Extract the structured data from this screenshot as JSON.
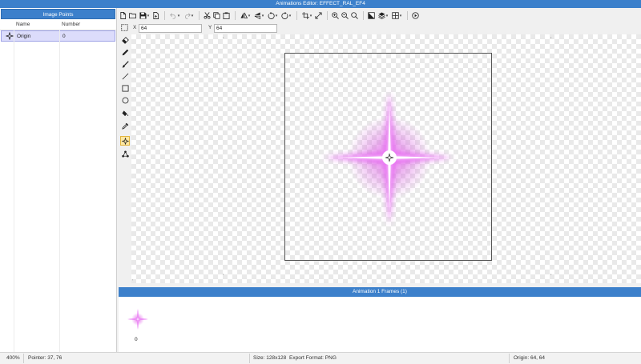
{
  "window": {
    "title": "Animations Editor: EFFECT_RAL_EF4"
  },
  "image_points": {
    "header": "Image Points",
    "columns": [
      "Name",
      "Number"
    ],
    "rows": [
      {
        "name": "Origin",
        "number": "0"
      }
    ]
  },
  "toolbar": {
    "icons": [
      "new-file-icon",
      "open-folder-icon",
      "save-icon",
      "export-icon",
      "undo-icon",
      "redo-icon",
      "cut-icon",
      "copy-icon",
      "paste-icon",
      "flip-horizontal-icon",
      "flip-vertical-icon",
      "rotate-left-icon",
      "rotate-right-icon",
      "crop-icon",
      "resize-icon",
      "zoom-in-icon",
      "zoom-out-icon",
      "zoom-reset-icon",
      "background-icon",
      "layers-icon",
      "grid-icon",
      "play-icon"
    ]
  },
  "coords": {
    "x_label": "X",
    "x_value": "64",
    "y_label": "Y",
    "y_value": "64"
  },
  "tools": [
    "select-icon",
    "eraser-icon",
    "pencil-icon",
    "brush-icon",
    "line-icon",
    "rectangle-icon",
    "ellipse-icon",
    "fill-icon",
    "eyedropper-icon",
    "origin-point-icon",
    "points-icon"
  ],
  "frames": {
    "header": "Animation 1 Frames (1)",
    "items": [
      {
        "number": "0"
      }
    ]
  },
  "status": {
    "zoom": "400%",
    "pointer": "Pointer: 37, 76",
    "size": "Size: 128x128",
    "export_format": "Export Format: PNG",
    "origin": "Origin: 64, 64"
  },
  "colors": {
    "accent": "#3c80cb",
    "selection_row": "#dcdcfb",
    "sprite": "#e020e8"
  }
}
